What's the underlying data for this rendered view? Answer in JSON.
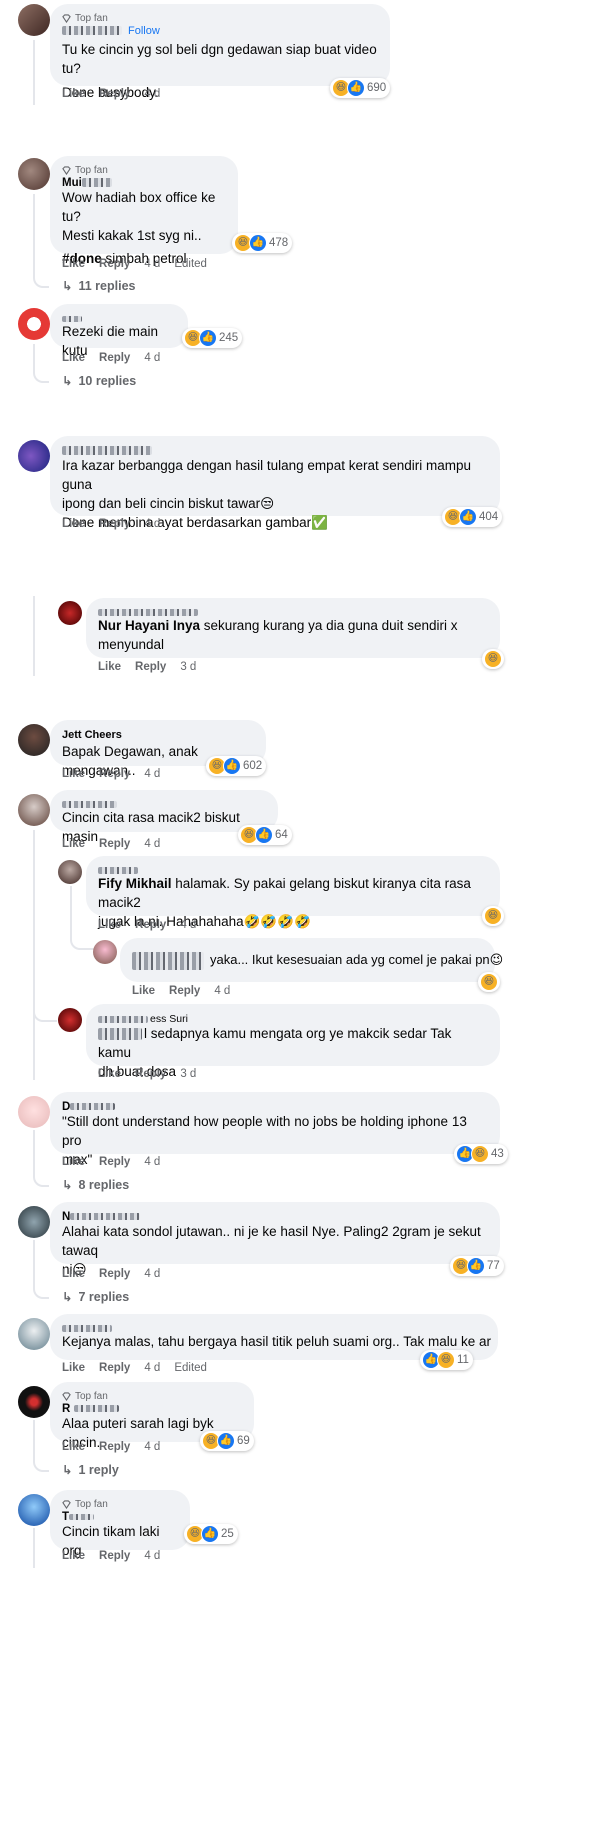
{
  "labels": {
    "top_fan": "Top fan",
    "follow": "Follow",
    "like": "Like",
    "reply": "Reply",
    "edited": "Edited"
  },
  "colors": {
    "accent": "#1877f2",
    "bubble": "#f0f2f5",
    "muted": "#65676b",
    "haha": "#f7b125"
  },
  "icons": {
    "top_fan": "gem-icon",
    "haha": "haha-emoji-icon",
    "like": "like-thumb-icon",
    "reply_arrow": "reply-arrow-icon"
  },
  "c1": {
    "line1": "Tu ke cincin yg sol beli dgn gedawan siap buat video tu?",
    "line2": "Done busybody.",
    "time": "4 d",
    "count": "690"
  },
  "c2": {
    "name_partial": "Mui",
    "line1": "Wow hadiah box office ke tu?",
    "line2": "Mesti kakak 1st syg ni..",
    "tag": "#done",
    "tag_rest": " simbah petrol",
    "time": "4 d",
    "count": "478",
    "replies": "11 replies"
  },
  "c3": {
    "text": "Rezeki die main kutu",
    "time": "4 d",
    "count": "245",
    "replies": "10 replies"
  },
  "c4": {
    "line1": "Ira kazar berbangga dengan hasil tulang empat kerat sendiri mampu guna",
    "line2": "ipong dan beli cincin biskut tawar😒",
    "line3": "Done membina ayat berdasarkan gambar✅",
    "time": "4 d",
    "count": "404"
  },
  "r1": {
    "mention": "Nur Hayani Inya",
    "text": " sekurang kurang ya dia guna duit sendiri x",
    "line2": "menyundal",
    "time": "3 d"
  },
  "c5": {
    "name": "Jett Cheers",
    "text": "Bapak Degawan, anak mengawan..",
    "time": "4 d",
    "count": "602"
  },
  "c6": {
    "text": "Cincin cita rasa macik2 biskut masin",
    "time": "4 d",
    "count": "64"
  },
  "r2": {
    "mention": "Fify Mikhail",
    "text": " halamak. Sy pakai gelang biskut kiranya cita rasa macik2",
    "line2": "jugak la ni. Hahahahaha🤣🤣🤣🤣",
    "time": "4 d"
  },
  "r3": {
    "text": "yaka... Ikut kesesuaian ada yg comel je pakai pn😉",
    "time": "4 d"
  },
  "r4": {
    "name_partial": "ess Suri",
    "line1": "l sedapnya kamu mengata org ye makcik sedar Tak kamu",
    "line2": "dh buat dosa",
    "time": "3 d"
  },
  "c7": {
    "name_partial": "D",
    "line1": "\"Still dont understand how people with no jobs be holding iphone 13 pro",
    "line2": "max\"",
    "time": "4 d",
    "count": "43",
    "replies": "8 replies"
  },
  "c8": {
    "name_partial": "N",
    "line1": "Alahai kata sondol jutawan.. ni je ke hasil Nye. Paling2 2gram je sekut tawaq",
    "line2": "ni😒",
    "time": "4 d",
    "count": "77",
    "replies": "7 replies"
  },
  "c9": {
    "text": "Kejanya malas, tahu bergaya hasil titik peluh suami org.. Tak malu ke ar",
    "time": "4 d",
    "count": "11"
  },
  "c10": {
    "name_partial": "R",
    "text": "Alaa puteri sarah lagi byk cincin.",
    "time": "4 d",
    "count": "69",
    "replies": "1 reply"
  },
  "c11": {
    "name_partial": "T",
    "text": "Cincin tikam laki org",
    "time": "4 d",
    "count": "25"
  }
}
